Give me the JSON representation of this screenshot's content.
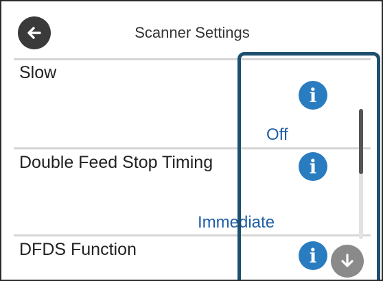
{
  "header": {
    "title": "Scanner Settings",
    "back_icon": "arrow-left-icon"
  },
  "settings": [
    {
      "label": "Slow",
      "value": "",
      "info_icon": "info-icon"
    },
    {
      "label": "Double Feed Stop Timing",
      "value": "Off",
      "info_icon": "info-icon"
    },
    {
      "label": "DFDS Function",
      "value": "Immediate",
      "info_icon": "info-icon"
    }
  ],
  "scroll": {
    "down_icon": "arrow-down-icon",
    "position": 0.0
  },
  "colors": {
    "accent": "#2a7cc0",
    "value_text": "#1f5ea6",
    "highlight": "#1d4f6e"
  }
}
